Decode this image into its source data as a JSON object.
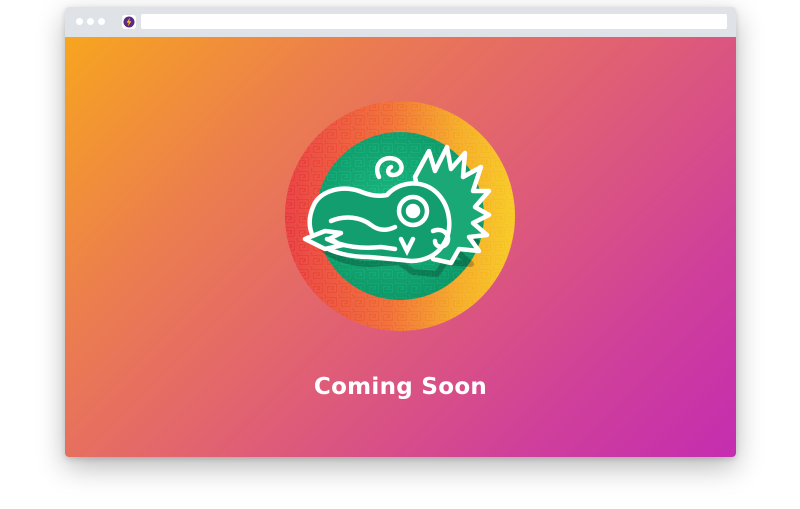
{
  "browser": {
    "window_controls": [
      "dot",
      "dot",
      "dot"
    ],
    "favicon_icon": "bolt-icon",
    "address": ""
  },
  "page": {
    "heading": "Coming Soon",
    "logo_icon": "quetzalcoatl-serpent-head-icon"
  },
  "colors": {
    "gradient_start": "#f7a51f",
    "gradient_end": "#c42db0",
    "ring_outer_left": "#e63a3a",
    "ring_outer_right": "#f7c51f",
    "logo_inner": "#16b37f",
    "text": "#ffffff"
  }
}
